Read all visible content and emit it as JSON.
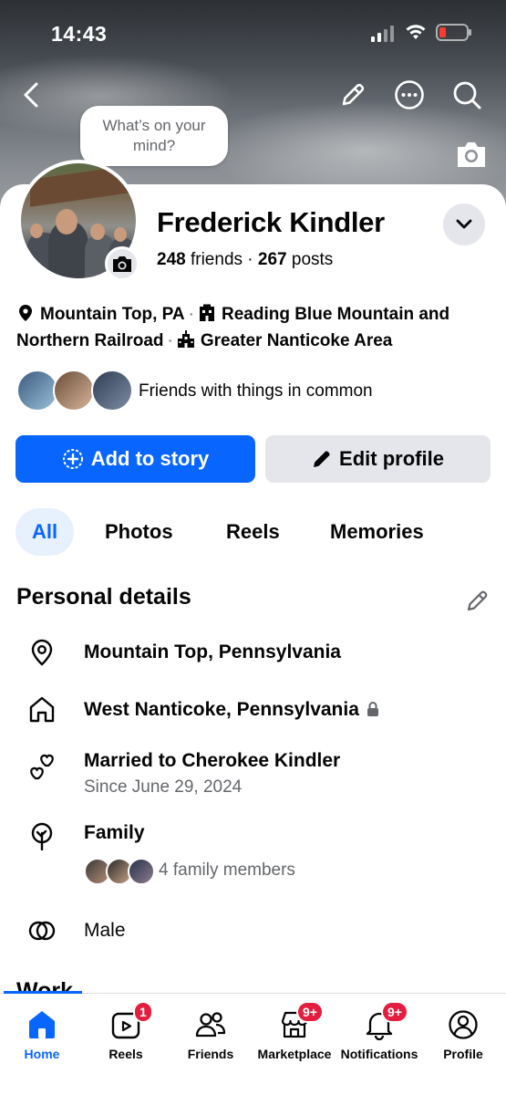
{
  "status_bar": {
    "time": "14:43"
  },
  "composer_bubble": {
    "text": "What’s on your mind?"
  },
  "profile": {
    "name": "Frederick Kindler",
    "friends_count": "248",
    "friends_label": "friends",
    "separator": "·",
    "posts_count": "267",
    "posts_label": "posts"
  },
  "intro": {
    "location": "Mountain Top, PA",
    "work": "Reading Blue Mountain and Northern Railroad",
    "school": "Greater Nanticoke Area",
    "dot": "·"
  },
  "mutual": {
    "label": "Friends with things in common"
  },
  "actions": {
    "add_story": "Add to story",
    "edit_profile": "Edit profile"
  },
  "tabs": [
    "All",
    "Photos",
    "Reels",
    "Memories"
  ],
  "personal_details": {
    "title": "Personal details",
    "current_city": "Mountain Top, Pennsylvania",
    "hometown": "West Nanticoke, Pennsylvania",
    "relationship": "Married to Cherokee Kindler",
    "relationship_since": "Since June 29, 2024",
    "family_title": "Family",
    "family_members": "4 family members",
    "gender": "Male"
  },
  "work_section": {
    "title": "Work"
  },
  "nav": {
    "items": [
      {
        "label": "Home",
        "icon": "home-icon",
        "badge": ""
      },
      {
        "label": "Reels",
        "icon": "reels-icon",
        "badge": "1"
      },
      {
        "label": "Friends",
        "icon": "friends-icon",
        "badge": ""
      },
      {
        "label": "Marketplace",
        "icon": "marketplace-icon",
        "badge": "9+"
      },
      {
        "label": "Notifications",
        "icon": "bell-icon",
        "badge": "9+"
      },
      {
        "label": "Profile",
        "icon": "profile-icon",
        "badge": ""
      }
    ]
  },
  "colors": {
    "accent": "#0866ff",
    "badge": "#e41e3f",
    "secondary_text": "#65676b",
    "button_gray": "#e4e6eb"
  }
}
